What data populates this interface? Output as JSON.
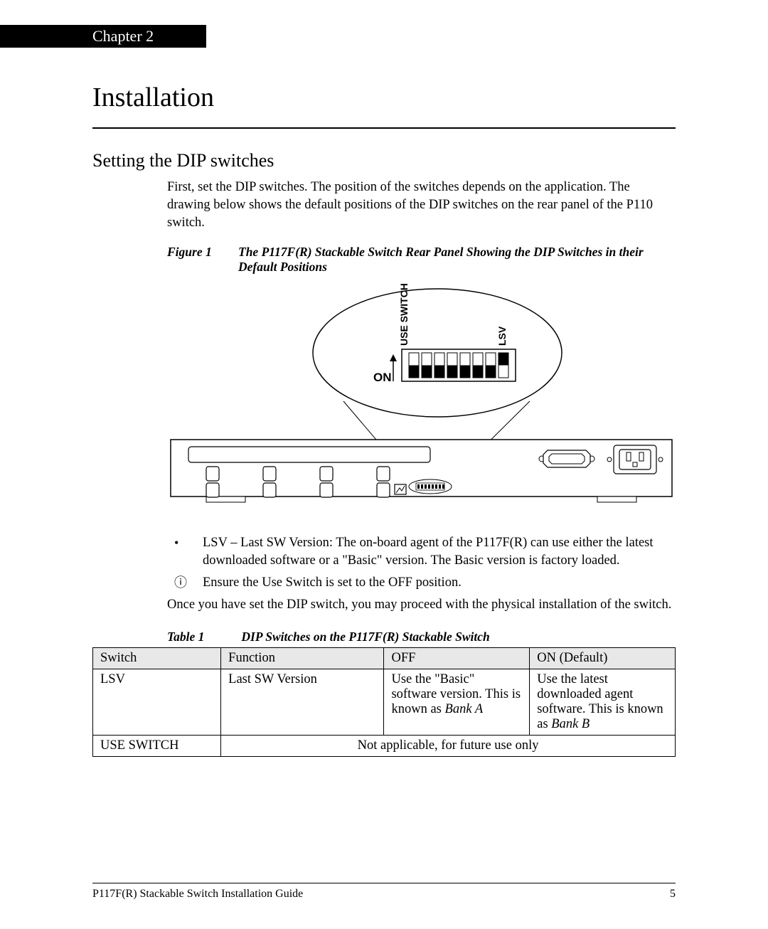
{
  "chapter": "Chapter 2",
  "title": "Installation",
  "section": "Setting the DIP switches",
  "intro": "First, set the DIP switches. The position of the switches depends on the application. The drawing below shows the default positions of the DIP switches on the rear panel of the P110 switch.",
  "figure": {
    "label": "Figure 1",
    "caption": "The P117F(R) Stackable Switch Rear Panel Showing the DIP Switches in their Default Positions",
    "labels": {
      "on": "ON",
      "use_switch": "USE SWITCH",
      "lsv": "LSV"
    }
  },
  "bullets": [
    {
      "mark": "•",
      "text": "LSV – Last SW Version: The on-board agent of the P117F(R) can use either the latest downloaded software or a \"Basic\" version. The Basic version is factory loaded."
    },
    {
      "mark": "ⓘ",
      "text": "Ensure the Use Switch is set to the OFF position."
    }
  ],
  "after_bullets": "Once you have set the DIP switch, you may proceed with the physical installation of the switch.",
  "table": {
    "label": "Table 1",
    "caption": "DIP Switches on the P117F(R) Stackable Switch",
    "headers": [
      "Switch",
      "Function",
      "OFF",
      "ON (Default)"
    ],
    "row1": {
      "switch": "LSV",
      "function": "Last SW Version",
      "off_pre": "Use the \"Basic\" software version. This is known as ",
      "off_em": "Bank A",
      "on_pre": "Use the latest downloaded agent software. This is known as ",
      "on_em": "Bank B"
    },
    "row2": {
      "switch": "USE SWITCH",
      "merged": "Not applicable, for future use only"
    }
  },
  "footer": {
    "left": "P117F(R) Stackable Switch Installation Guide",
    "right": "5"
  }
}
